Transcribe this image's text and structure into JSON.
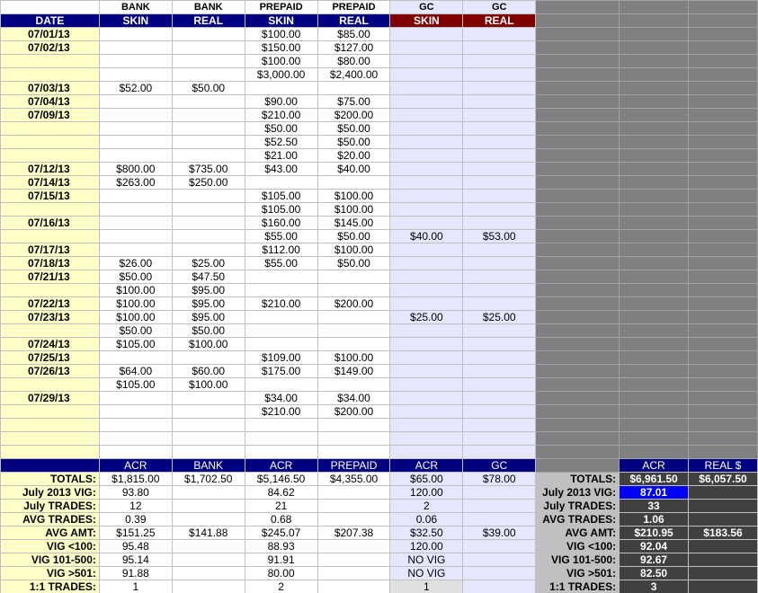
{
  "header_top": [
    "",
    "BANK",
    "BANK",
    "PREPAID",
    "PREPAID",
    "GC",
    "GC"
  ],
  "header_sub": [
    "DATE",
    "SKIN",
    "REAL",
    "SKIN",
    "REAL",
    "SKIN",
    "REAL"
  ],
  "rows": [
    [
      "07/01/13",
      "",
      "",
      "$100.00",
      "$85.00",
      "",
      ""
    ],
    [
      "07/02/13",
      "",
      "",
      "$150.00",
      "$127.00",
      "",
      ""
    ],
    [
      "",
      "",
      "",
      "$100.00",
      "$80.00",
      "",
      ""
    ],
    [
      "",
      "",
      "",
      "$3,000.00",
      "$2,400.00",
      "",
      ""
    ],
    [
      "07/03/13",
      "$52.00",
      "$50.00",
      "",
      "",
      "",
      ""
    ],
    [
      "07/04/13",
      "",
      "",
      "$90.00",
      "$75.00",
      "",
      ""
    ],
    [
      "07/09/13",
      "",
      "",
      "$210.00",
      "$200.00",
      "",
      ""
    ],
    [
      "",
      "",
      "",
      "$50.00",
      "$50.00",
      "",
      ""
    ],
    [
      "",
      "",
      "",
      "$52.50",
      "$50.00",
      "",
      ""
    ],
    [
      "",
      "",
      "",
      "$21.00",
      "$20.00",
      "",
      ""
    ],
    [
      "07/12/13",
      "$800.00",
      "$735.00",
      "$43.00",
      "$40.00",
      "",
      ""
    ],
    [
      "07/14/13",
      "$263.00",
      "$250.00",
      "",
      "",
      "",
      ""
    ],
    [
      "07/15/13",
      "",
      "",
      "$105.00",
      "$100.00",
      "",
      ""
    ],
    [
      "",
      "",
      "",
      "$105.00",
      "$100.00",
      "",
      ""
    ],
    [
      "07/16/13",
      "",
      "",
      "$160.00",
      "$145.00",
      "",
      ""
    ],
    [
      "",
      "",
      "",
      "$55.00",
      "$50.00",
      "$40.00",
      "$53.00"
    ],
    [
      "07/17/13",
      "",
      "",
      "$112.00",
      "$100.00",
      "",
      ""
    ],
    [
      "07/18/13",
      "$26.00",
      "$25.00",
      "$55.00",
      "$50.00",
      "",
      ""
    ],
    [
      "07/21/13",
      "$50.00",
      "$47.50",
      "",
      "",
      "",
      ""
    ],
    [
      "",
      "$100.00",
      "$95.00",
      "",
      "",
      "",
      ""
    ],
    [
      "07/22/13",
      "$100.00",
      "$95.00",
      "$210.00",
      "$200.00",
      "",
      ""
    ],
    [
      "07/23/13",
      "$100.00",
      "$95.00",
      "",
      "",
      "$25.00",
      "$25.00"
    ],
    [
      "",
      "$50.00",
      "$50.00",
      "",
      "",
      "",
      ""
    ],
    [
      "07/24/13",
      "$105.00",
      "$100.00",
      "",
      "",
      "",
      ""
    ],
    [
      "07/25/13",
      "",
      "",
      "$109.00",
      "$100.00",
      "",
      ""
    ],
    [
      "07/26/13",
      "$64.00",
      "$60.00",
      "$175.00",
      "$149.00",
      "",
      ""
    ],
    [
      "",
      "$105.00",
      "$100.00",
      "",
      "",
      "",
      ""
    ],
    [
      "07/29/13",
      "",
      "",
      "$34.00",
      "$34.00",
      "",
      ""
    ],
    [
      "",
      "",
      "",
      "$210.00",
      "$200.00",
      "",
      ""
    ],
    [
      "",
      "",
      "",
      "",
      "",
      "",
      ""
    ],
    [
      "",
      "",
      "",
      "",
      "",
      "",
      ""
    ],
    [
      "",
      "",
      "",
      "",
      "",
      "",
      ""
    ]
  ],
  "summary_header": [
    "ACR",
    "BANK",
    "ACR",
    "PREPAID",
    "ACR",
    "GC"
  ],
  "summary_rows": [
    {
      "label": "TOTALS:",
      "vals": [
        "$1,815.00",
        "$1,702.50",
        "$5,146.50",
        "$4,355.00",
        "$65.00",
        "$78.00"
      ]
    },
    {
      "label": "July 2013 VIG:",
      "vals": [
        "93.80",
        "",
        "84.62",
        "",
        "120.00",
        ""
      ]
    },
    {
      "label": "July TRADES:",
      "vals": [
        "12",
        "",
        "21",
        "",
        "2",
        ""
      ]
    },
    {
      "label": "AVG TRADES:",
      "vals": [
        "0.39",
        "",
        "0.68",
        "",
        "0.06",
        ""
      ]
    },
    {
      "label": "AVG AMT:",
      "vals": [
        "$151.25",
        "$141.88",
        "$245.07",
        "$207.38",
        "$32.50",
        "$39.00"
      ]
    },
    {
      "label": "VIG <100:",
      "vals": [
        "95.48",
        "",
        "88.93",
        "",
        "120.00",
        ""
      ]
    },
    {
      "label": "VIG 101-500:",
      "vals": [
        "95.14",
        "",
        "91.91",
        "",
        "NO VIG",
        ""
      ]
    },
    {
      "label": "VIG >501:",
      "vals": [
        "91.88",
        "",
        "80.00",
        "",
        "NO VIG",
        ""
      ]
    },
    {
      "label": "1:1 TRADES:",
      "vals": [
        "1",
        "",
        "2",
        "",
        "1",
        ""
      ]
    }
  ],
  "totals_header": [
    "ACR",
    "REAL $"
  ],
  "totals_rows": [
    {
      "label": "TOTALS:",
      "vals": [
        "$6,961.50",
        "$6,057.50"
      ]
    },
    {
      "label": "July 2013 VIG:",
      "vals": [
        "87.01",
        ""
      ]
    },
    {
      "label": "July TRADES:",
      "vals": [
        "33",
        ""
      ]
    },
    {
      "label": "AVG TRADES:",
      "vals": [
        "1.06",
        ""
      ]
    },
    {
      "label": "AVG AMT:",
      "vals": [
        "$210.95",
        "$183.56"
      ]
    },
    {
      "label": "VIG <100:",
      "vals": [
        "92.04",
        ""
      ]
    },
    {
      "label": "VIG 101-500:",
      "vals": [
        "92.67",
        ""
      ]
    },
    {
      "label": "VIG >501:",
      "vals": [
        "82.50",
        ""
      ]
    },
    {
      "label": "1:1 TRADES:",
      "vals": [
        "3",
        ""
      ]
    }
  ],
  "colors": {
    "header_navy": "#000080",
    "header_maroon": "#800000",
    "date_yellow": "#ffffc8",
    "gc_lavender": "#e6e6ff",
    "gray": "#808080",
    "dark": "#404040",
    "selected": "#0000ff"
  }
}
